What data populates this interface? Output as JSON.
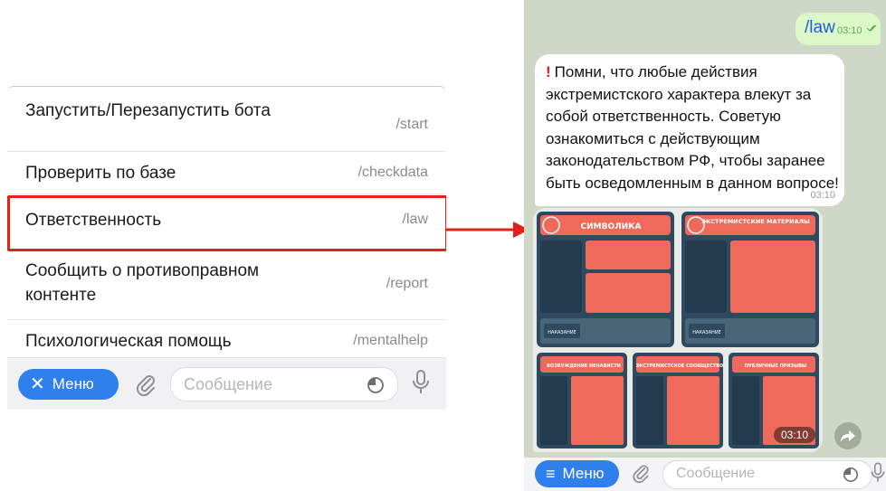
{
  "left_menu": {
    "items": [
      {
        "label": "Запустить/Перезапустить бота",
        "command": "/start"
      },
      {
        "label": "Проверить по базе",
        "command": "/checkdata"
      },
      {
        "label": "Ответственность",
        "command": "/law"
      },
      {
        "label": "Сообщить о противоправном контенте",
        "command": "/report"
      },
      {
        "label": "Психологическая помощь",
        "command": "/mentalhelp"
      }
    ],
    "highlighted_command": "/law",
    "highlight_color": "#e5211b"
  },
  "input_bar": {
    "menu_label": "Меню",
    "placeholder": "Сообщение"
  },
  "chat": {
    "sent": {
      "text": "/law",
      "time": "03:10"
    },
    "warning": {
      "text": "Помни, что любые действия экстремистского характера влекут за собой ответственность. Советую ознакомиться с действующим законодательством РФ, чтобы заранее быть осведомленным в данном вопросе!",
      "time": "03:10"
    },
    "infographic": {
      "time": "03:10",
      "headers": [
        "СИМВОЛИКА",
        "ЭКСТРЕМИСТСКИЕ МАТЕРИАЛЫ",
        "ВОЗБУЖДЕНИЕ НЕНАВИСТИ",
        "ЭКСТРЕМИСТСКОЕ СООБЩЕСТВО",
        "ПУБЛИЧНЫЕ ПРИЗЫВЫ"
      ],
      "labels": [
        "НАКАЗАНИЕ",
        "НАКАЗАНИЕ"
      ]
    },
    "input_bar": {
      "menu_label": "Меню",
      "placeholder": "Сообщение"
    }
  },
  "colors": {
    "accent_blue": "#2f80ed",
    "highlight_red": "#e5211b",
    "chat_background": "#cfd8c6",
    "sent_bubble": "#dcf8c6",
    "infographic_dark": "#2e4a60",
    "infographic_coral": "#ef6a5a"
  }
}
